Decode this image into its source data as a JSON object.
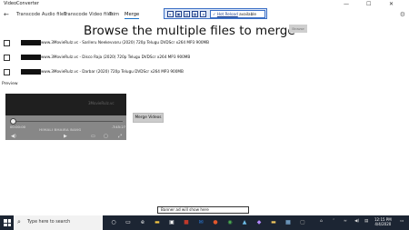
{
  "window": {
    "title": "VideoConverter",
    "controls": [
      "—",
      "☐",
      "✕"
    ]
  },
  "nav": {
    "back_icon": "back-arrow-icon",
    "tabs": [
      {
        "label": "Transcode Audio files"
      },
      {
        "label": "Transcode Video files"
      },
      {
        "label": "Trim"
      },
      {
        "label": "Merge"
      }
    ],
    "active_tab": "Merge",
    "settings_icon": "gear-icon"
  },
  "recorder_overlay": {
    "text_prefix": "",
    "link_text": "Hot Reload",
    "text_suffix": " available"
  },
  "main": {
    "heading": "Browse the multiple files to merge",
    "browse_label": "Browse",
    "files": [
      {
        "name": "www.3MovieRulz.vc - Sarileru Neekevvaru (2020) 720p Telugu DVDScr x264 MP3 900MB",
        "checked": false
      },
      {
        "name": "www.3MovieRulz.vc - Disco Raja (2020) 720p Telugu DVDScr x264 MP3 900MB",
        "checked": false
      },
      {
        "name": "www.3MovieRulz.vc - Darbar (2020) 720p Telugu DVDScr x264 MP3 900MB",
        "checked": false
      }
    ]
  },
  "preview": {
    "label": "Preview",
    "watermark": "3MovieRulz.vc",
    "elapsed": "00:00:00",
    "remaining": "-T:45:27",
    "caption": "HIMALI BHAIRA BANG",
    "progress": 0.0
  },
  "merge_label": "Merge Videos",
  "ad_text": "Banner ad will show here",
  "taskbar": {
    "search_placeholder": "Type here to search",
    "time": "12:15 PM",
    "date": "4/4/2020",
    "accent": "#1c2533"
  }
}
